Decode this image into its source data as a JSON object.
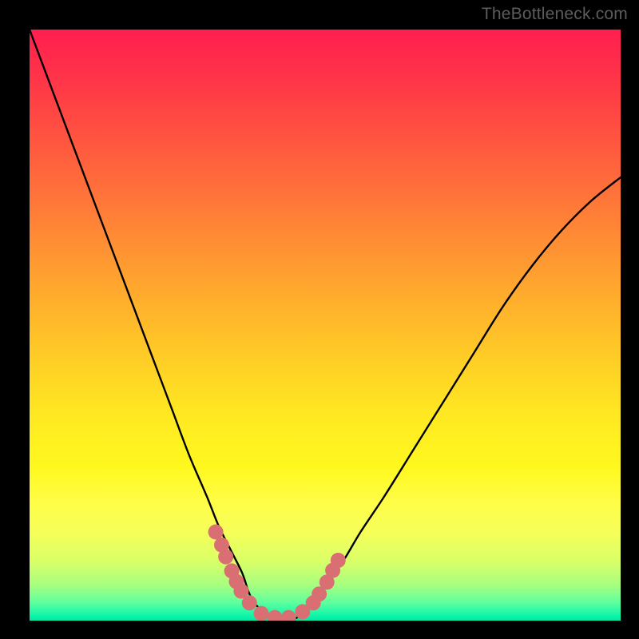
{
  "watermark": {
    "text": "TheBottleneck.com"
  },
  "chart_data": {
    "type": "line",
    "title": "",
    "xlabel": "",
    "ylabel": "",
    "xlim": [
      0,
      1
    ],
    "ylim": [
      0,
      1
    ],
    "series": [
      {
        "name": "bottleneck-curve",
        "x": [
          0.0,
          0.03,
          0.06,
          0.09,
          0.12,
          0.15,
          0.18,
          0.21,
          0.24,
          0.27,
          0.3,
          0.32,
          0.34,
          0.36,
          0.37,
          0.38,
          0.39,
          0.4,
          0.42,
          0.44,
          0.46,
          0.48,
          0.5,
          0.53,
          0.56,
          0.6,
          0.65,
          0.7,
          0.75,
          0.8,
          0.85,
          0.9,
          0.95,
          1.0
        ],
        "y": [
          1.0,
          0.92,
          0.84,
          0.76,
          0.68,
          0.6,
          0.52,
          0.44,
          0.36,
          0.28,
          0.21,
          0.16,
          0.12,
          0.08,
          0.05,
          0.03,
          0.02,
          0.01,
          0.0,
          0.0,
          0.01,
          0.03,
          0.06,
          0.1,
          0.15,
          0.21,
          0.29,
          0.37,
          0.45,
          0.53,
          0.6,
          0.66,
          0.71,
          0.75
        ]
      }
    ],
    "markers": [
      {
        "name": "highlight-dots",
        "color": "#da6f73",
        "points": [
          {
            "x": 0.315,
            "y": 0.15
          },
          {
            "x": 0.325,
            "y": 0.128
          },
          {
            "x": 0.332,
            "y": 0.108
          },
          {
            "x": 0.342,
            "y": 0.084
          },
          {
            "x": 0.35,
            "y": 0.066
          },
          {
            "x": 0.358,
            "y": 0.05
          },
          {
            "x": 0.372,
            "y": 0.03
          },
          {
            "x": 0.392,
            "y": 0.012
          },
          {
            "x": 0.415,
            "y": 0.005
          },
          {
            "x": 0.438,
            "y": 0.005
          },
          {
            "x": 0.462,
            "y": 0.015
          },
          {
            "x": 0.48,
            "y": 0.03
          },
          {
            "x": 0.49,
            "y": 0.045
          },
          {
            "x": 0.503,
            "y": 0.065
          },
          {
            "x": 0.513,
            "y": 0.085
          },
          {
            "x": 0.522,
            "y": 0.102
          }
        ]
      }
    ],
    "background": {
      "type": "vertical-gradient",
      "stops": [
        {
          "pos": 0.0,
          "color": "#ff1f4f"
        },
        {
          "pos": 0.5,
          "color": "#ffd726"
        },
        {
          "pos": 0.8,
          "color": "#fffd47"
        },
        {
          "pos": 1.0,
          "color": "#00e8a4"
        }
      ]
    },
    "annotations": []
  }
}
